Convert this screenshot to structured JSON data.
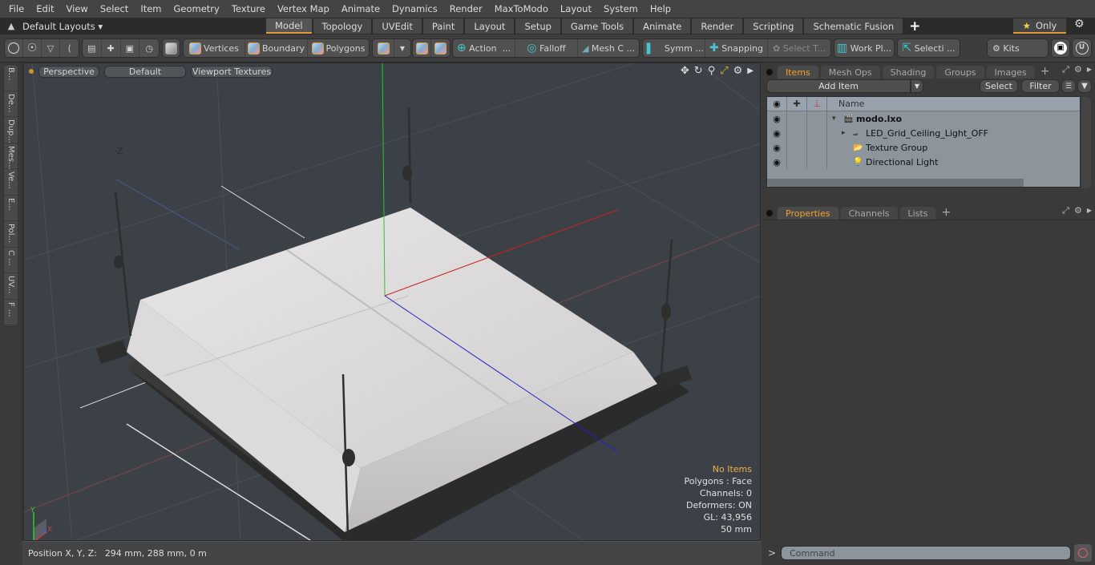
{
  "menu": [
    "File",
    "Edit",
    "View",
    "Select",
    "Item",
    "Geometry",
    "Texture",
    "Vertex Map",
    "Animate",
    "Dynamics",
    "Render",
    "MaxToModo",
    "Layout",
    "System",
    "Help"
  ],
  "layout_bar": {
    "layout_select": "Default Layouts ▾",
    "tabs": [
      "Model",
      "Topology",
      "UVEdit",
      "Paint",
      "Layout",
      "Setup",
      "Game Tools",
      "Animate",
      "Render",
      "Scripting",
      "Schematic Fusion"
    ],
    "active_tab": "Model",
    "plus": "+",
    "only_label": "Only",
    "only_star": "★",
    "gear": "⚙"
  },
  "toolbar": {
    "vertices": "Vertices",
    "boundary": "Boundary",
    "polygons": "Polygons",
    "action": "Action",
    "falloff": "Falloff",
    "mesh_c": "Mesh C ...",
    "symm": "Symm ...",
    "snapping": "Snapping",
    "select_t": "Select T...",
    "work_pl": "Work Pl...",
    "selecti": "Selecti ...",
    "kits": "Kits",
    "ellipsis": "..."
  },
  "left_tabs": [
    "B...",
    "De...",
    "Dup...",
    "Mes...",
    "Ve...",
    "E...",
    "Pol...",
    "C ...",
    "UV...",
    "F ..."
  ],
  "viewport": {
    "view_mode": "Perspective",
    "shading": "Default",
    "textures": "Viewport Textures",
    "axis_label_neg_z": "-Z",
    "info": {
      "selection": "No Items",
      "polygons": "Polygons : Face",
      "channels": "Channels: 0",
      "deformers": "Deformers: ON",
      "gl": "GL: 43,956",
      "scale": "50 mm"
    },
    "gizmo": {
      "x": "X",
      "y": "Y",
      "z": "Z"
    }
  },
  "status": {
    "label": "Position X, Y, Z:",
    "value": "294 mm, 288 mm, 0 m"
  },
  "items_panel": {
    "tabs": [
      "Items",
      "Mesh Ops",
      "Shading",
      "Groups",
      "Images"
    ],
    "active_tab": "Items",
    "add_item": "Add Item",
    "select": "Select",
    "filter": "Filter",
    "column_name": "Name",
    "rows": [
      {
        "name": "modo.lxo",
        "indent": 0,
        "bold": true,
        "expander": "▾",
        "icon": "🎬"
      },
      {
        "name": "LED_Grid_Ceiling_Light_OFF",
        "indent": 1,
        "bold": false,
        "expander": "▸",
        "icon": "⨼"
      },
      {
        "name": "Texture Group",
        "indent": 1,
        "bold": false,
        "expander": "",
        "icon": "📂"
      },
      {
        "name": "Directional Light",
        "indent": 1,
        "bold": false,
        "expander": "",
        "icon": "💡"
      }
    ]
  },
  "properties_panel": {
    "tabs": [
      "Properties",
      "Channels",
      "Lists"
    ],
    "active_tab": "Properties"
  },
  "command": {
    "prompt": ">",
    "placeholder": "Command"
  },
  "colors": {
    "accent": "#e39a3a",
    "active_tab_text": "#f0a030",
    "viewport_bg": "#3c4147",
    "axis_x": "#d02020",
    "axis_y": "#20d020",
    "axis_z": "#2020d0"
  }
}
